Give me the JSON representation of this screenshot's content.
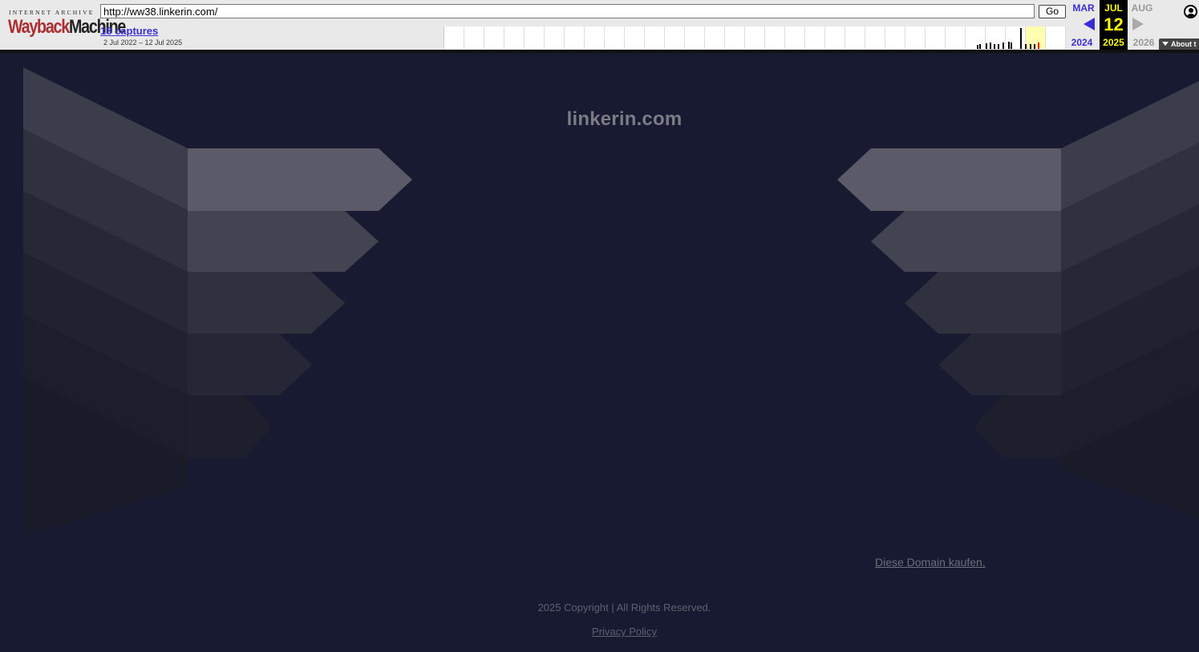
{
  "wayback": {
    "logo_top": "INTERNET ARCHIVE",
    "logo_wayback": "Wayback",
    "logo_machine": "Machine",
    "url": "http://ww38.linkerin.com/",
    "go_label": "Go",
    "captures": "18 captures",
    "date_range": "2 Jul 2022 – 12 Jul 2025",
    "prev_month": "MAR",
    "prev_year": "2024",
    "current_month": "JUL",
    "current_day": "12",
    "current_year": "2025",
    "next_month": "AUG",
    "next_year": "2026",
    "about_label": "About t",
    "icons": {
      "prev": "triangle-left-icon",
      "next": "triangle-right-icon",
      "user": "user-circle-icon"
    },
    "colors": {
      "link": "#3b2dd6",
      "current_bg": "#000000",
      "current_text": "#ffff00",
      "highlight": "#ffffb0"
    }
  },
  "page": {
    "title": "linkerin.com",
    "buy_link": "Diese Domain kaufen.",
    "copyright": "2025 Copyright | All Rights Reserved.",
    "privacy": "Privacy Policy",
    "colors": {
      "background": "#171a31",
      "text": "#7b7c86"
    }
  }
}
